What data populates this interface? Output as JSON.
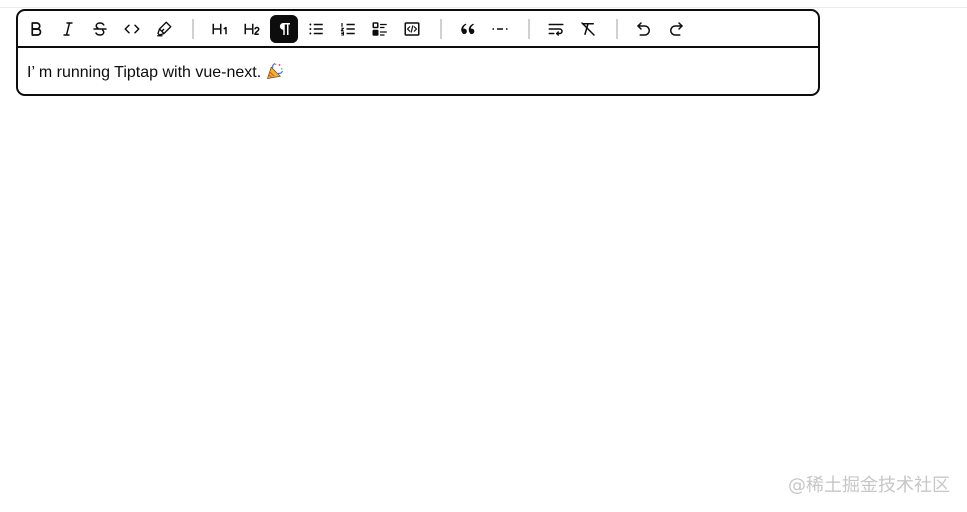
{
  "toolbar": {
    "buttons": [
      {
        "name": "bold",
        "icon": "bold-icon",
        "active": false
      },
      {
        "name": "italic",
        "icon": "italic-icon",
        "active": false
      },
      {
        "name": "strike",
        "icon": "strikethrough-icon",
        "active": false
      },
      {
        "name": "code",
        "icon": "code-icon",
        "active": false
      },
      {
        "name": "highlight",
        "icon": "highlighter-icon",
        "active": false
      },
      {
        "name": "heading-1",
        "icon": "heading-1-icon",
        "active": false
      },
      {
        "name": "heading-2",
        "icon": "heading-2-icon",
        "active": false
      },
      {
        "name": "paragraph",
        "icon": "paragraph-icon",
        "active": true
      },
      {
        "name": "bullet-list",
        "icon": "bullet-list-icon",
        "active": false
      },
      {
        "name": "ordered-list",
        "icon": "ordered-list-icon",
        "active": false
      },
      {
        "name": "task-list",
        "icon": "task-list-icon",
        "active": false
      },
      {
        "name": "code-block",
        "icon": "code-block-icon",
        "active": false
      },
      {
        "name": "blockquote",
        "icon": "double-quotes-icon",
        "active": false
      },
      {
        "name": "horizontal-rule",
        "icon": "separator-icon",
        "active": false
      },
      {
        "name": "hard-break",
        "icon": "text-wrap-icon",
        "active": false
      },
      {
        "name": "clear-format",
        "icon": "format-clear-icon",
        "active": false
      },
      {
        "name": "undo",
        "icon": "undo-icon",
        "active": false
      },
      {
        "name": "redo",
        "icon": "redo-icon",
        "active": false
      }
    ]
  },
  "editor": {
    "text": "I’ m running Tiptap with vue-next.",
    "emoji": "party-popper-icon"
  },
  "watermark": "@稀土掘金技术社区",
  "colors": {
    "ink": "#0d0d0d",
    "active_bg": "#0d0d0d",
    "active_fg": "#ffffff",
    "separator": "#d0d0d0",
    "watermark": "#c7c7c7"
  }
}
